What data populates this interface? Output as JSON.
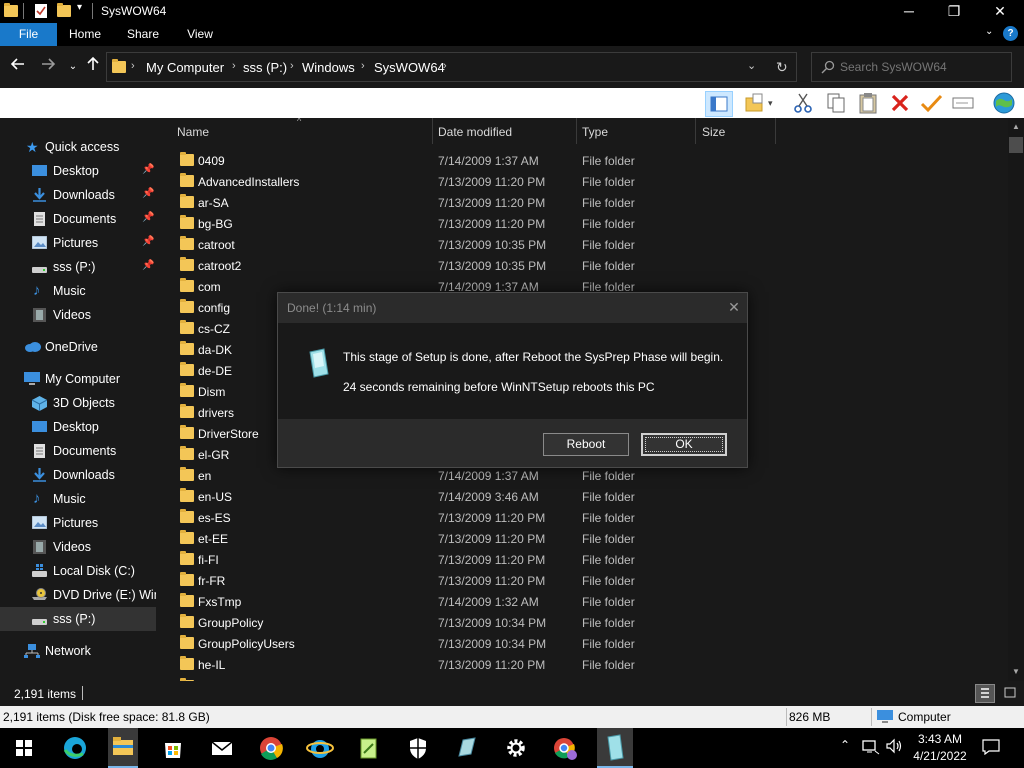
{
  "window": {
    "title": "SysWOW64"
  },
  "ribbon": {
    "tabs": [
      "File",
      "Home",
      "Share",
      "View"
    ]
  },
  "address": {
    "crumbs": [
      "My Computer",
      "sss (P:)",
      "Windows",
      "SysWOW64"
    ],
    "search_placeholder": "Search SysWOW64"
  },
  "nav": {
    "quick_access": "Quick access",
    "qa_items": [
      "Desktop",
      "Downloads",
      "Documents",
      "Pictures",
      "sss (P:)",
      "Music",
      "Videos"
    ],
    "onedrive": "OneDrive",
    "my_computer": "My Computer",
    "pc_items": [
      "3D Objects",
      "Desktop",
      "Documents",
      "Downloads",
      "Music",
      "Pictures",
      "Videos",
      "Local Disk (C:)",
      "DVD Drive (E:) Wind",
      "sss (P:)"
    ],
    "network": "Network"
  },
  "columns": {
    "name": "Name",
    "date": "Date modified",
    "type": "Type",
    "size": "Size"
  },
  "files": [
    {
      "name": "0409",
      "date": "7/14/2009 1:37 AM",
      "type": "File folder"
    },
    {
      "name": "AdvancedInstallers",
      "date": "7/13/2009 11:20 PM",
      "type": "File folder"
    },
    {
      "name": "ar-SA",
      "date": "7/13/2009 11:20 PM",
      "type": "File folder"
    },
    {
      "name": "bg-BG",
      "date": "7/13/2009 11:20 PM",
      "type": "File folder"
    },
    {
      "name": "catroot",
      "date": "7/13/2009 10:35 PM",
      "type": "File folder"
    },
    {
      "name": "catroot2",
      "date": "7/13/2009 10:35 PM",
      "type": "File folder"
    },
    {
      "name": "com",
      "date": "7/14/2009 1:37 AM",
      "type": "File folder"
    },
    {
      "name": "config",
      "date": "",
      "type": ""
    },
    {
      "name": "cs-CZ",
      "date": "",
      "type": ""
    },
    {
      "name": "da-DK",
      "date": "",
      "type": ""
    },
    {
      "name": "de-DE",
      "date": "",
      "type": ""
    },
    {
      "name": "Dism",
      "date": "",
      "type": ""
    },
    {
      "name": "drivers",
      "date": "",
      "type": ""
    },
    {
      "name": "DriverStore",
      "date": "",
      "type": ""
    },
    {
      "name": "el-GR",
      "date": "",
      "type": ""
    },
    {
      "name": "en",
      "date": "7/14/2009 1:37 AM",
      "type": "File folder"
    },
    {
      "name": "en-US",
      "date": "7/14/2009 3:46 AM",
      "type": "File folder"
    },
    {
      "name": "es-ES",
      "date": "7/13/2009 11:20 PM",
      "type": "File folder"
    },
    {
      "name": "et-EE",
      "date": "7/13/2009 11:20 PM",
      "type": "File folder"
    },
    {
      "name": "fi-FI",
      "date": "7/13/2009 11:20 PM",
      "type": "File folder"
    },
    {
      "name": "fr-FR",
      "date": "7/13/2009 11:20 PM",
      "type": "File folder"
    },
    {
      "name": "FxsTmp",
      "date": "7/14/2009 1:32 AM",
      "type": "File folder"
    },
    {
      "name": "GroupPolicy",
      "date": "7/13/2009 10:34 PM",
      "type": "File folder"
    },
    {
      "name": "GroupPolicyUsers",
      "date": "7/13/2009 10:34 PM",
      "type": "File folder"
    },
    {
      "name": "he-IL",
      "date": "7/13/2009 11:20 PM",
      "type": "File folder"
    }
  ],
  "status": {
    "items": "2,191 items"
  },
  "details_bar": {
    "summary": "2,191 items (Disk free space: 81.8 GB)",
    "size": "826 MB",
    "location": "Computer"
  },
  "dialog": {
    "title": "Done! (1:14 min)",
    "message": "This stage of Setup is done, after Reboot the SysPrep Phase will begin.",
    "countdown": "24 seconds remaining before WinNTSetup reboots this PC",
    "reboot_label": "Reboot",
    "ok_label": "OK"
  },
  "taskbar": {
    "time": "3:43 AM",
    "date": "4/21/2022"
  }
}
